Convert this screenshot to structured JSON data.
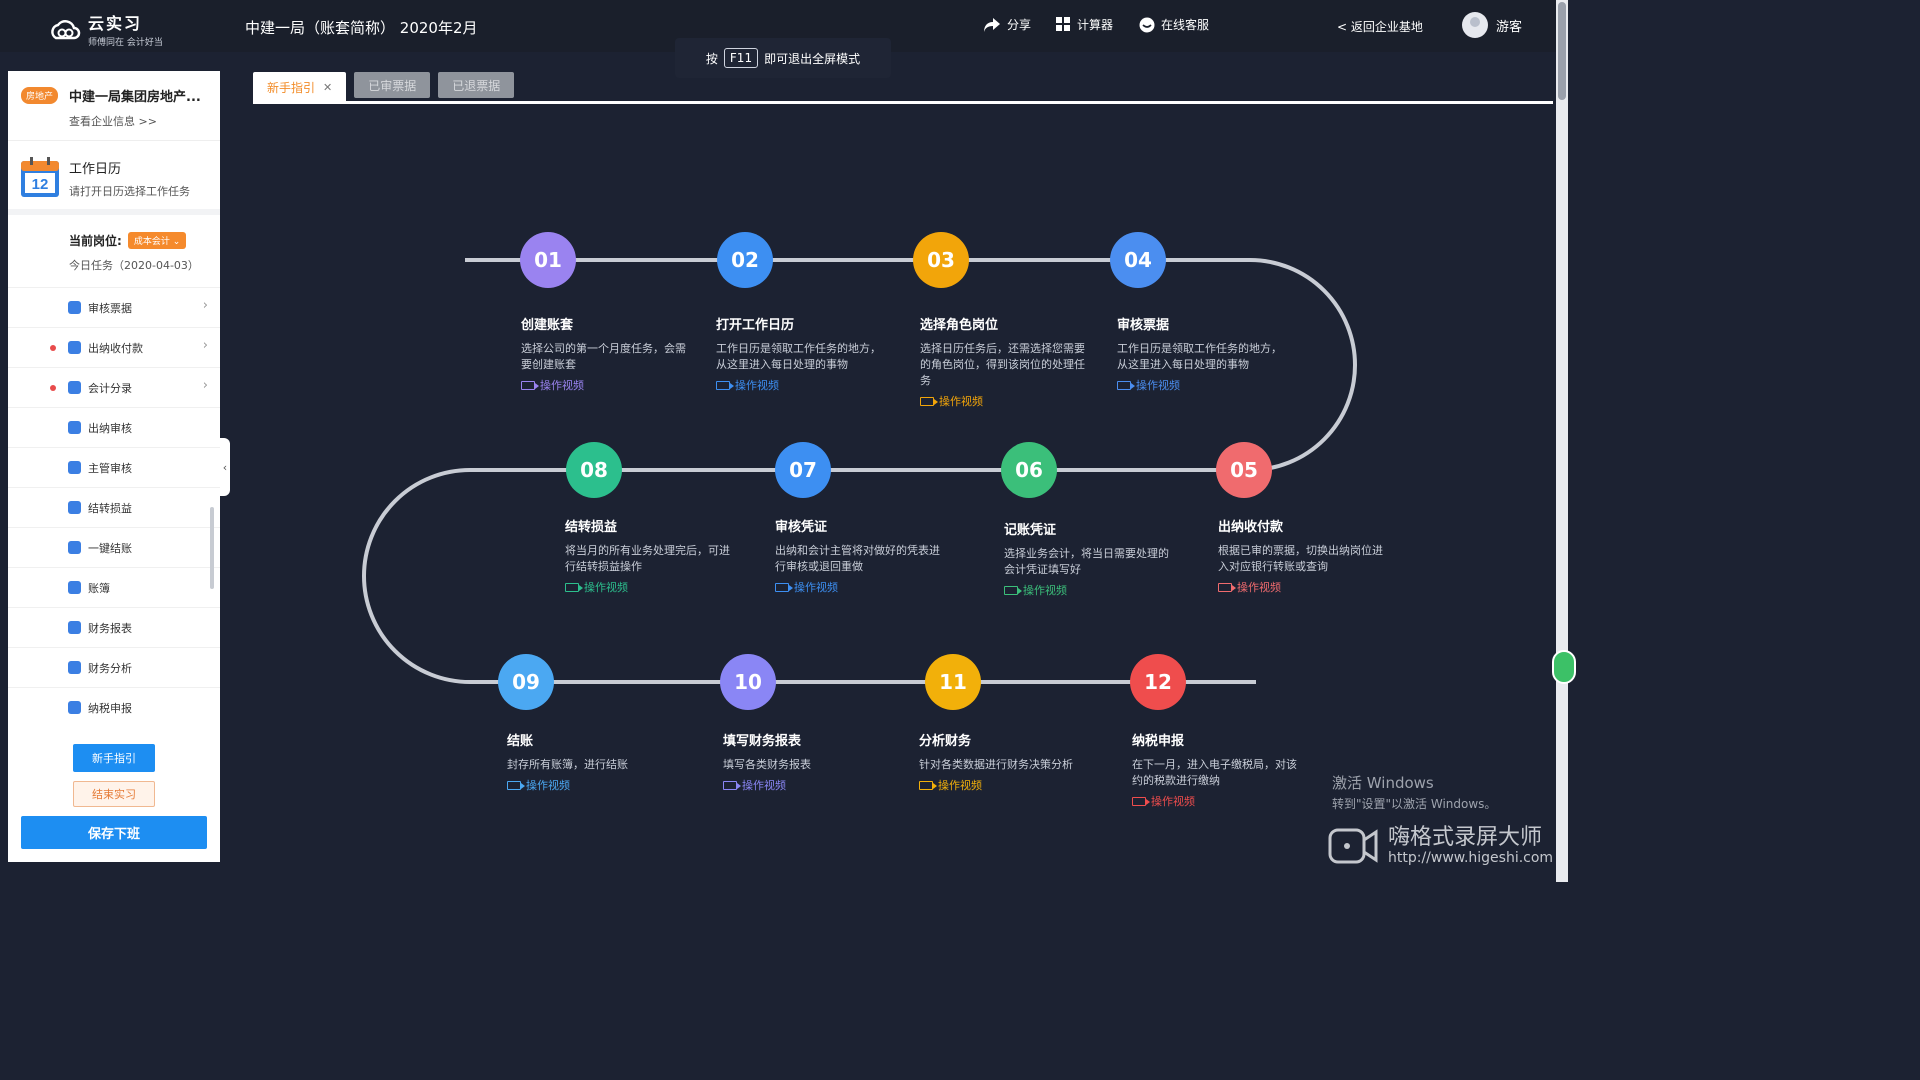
{
  "topbar": {
    "logo_title": "云实习",
    "logo_sub": "师傅同在 会计好当",
    "company_title": "中建一局（账套简称） 2020年2月",
    "f11_press": "按",
    "f11_key": "F11",
    "f11_text": "即可退出全屏模式",
    "share": "分享",
    "calculator": "计算器",
    "support": "在线客服",
    "back": "< 返回企业基地",
    "user": "游客"
  },
  "sidebar": {
    "badge": "房地产",
    "company_name": "中建一局集团房地产...",
    "company_link": "查看企业信息 >>",
    "calendar_day": "12",
    "calendar_title": "工作日历",
    "calendar_sub": "请打开日历选择工作任务",
    "post_label": "当前岗位:",
    "post_value": "成本会计",
    "today": "今日任务（2020-04-03）",
    "items": [
      {
        "label": "审核票据",
        "dot": false,
        "chev": true
      },
      {
        "label": "出纳收付款",
        "dot": true,
        "chev": true
      },
      {
        "label": "会计分录",
        "dot": true,
        "chev": true
      },
      {
        "label": "出纳审核",
        "dot": false,
        "chev": false
      },
      {
        "label": "主管审核",
        "dot": false,
        "chev": false
      },
      {
        "label": "结转损益",
        "dot": false,
        "chev": false
      },
      {
        "label": "一键结账",
        "dot": false,
        "chev": false
      },
      {
        "label": "账簿",
        "dot": false,
        "chev": false
      },
      {
        "label": "财务报表",
        "dot": false,
        "chev": false
      },
      {
        "label": "财务分析",
        "dot": false,
        "chev": false
      },
      {
        "label": "纳税申报",
        "dot": false,
        "chev": false
      }
    ],
    "btn_guide": "新手指引",
    "btn_end": "结束实习",
    "btn_save": "保存下班"
  },
  "tabs": [
    {
      "label": "新手指引",
      "active": true
    },
    {
      "label": "已审票据",
      "active": false
    },
    {
      "label": "已退票据",
      "active": false
    }
  ],
  "video_label": "操作视频",
  "steps": [
    {
      "num": "01",
      "title": "创建账套",
      "desc": "选择公司的第一个月度任务，会需要创建账套",
      "color": "#9a83f0"
    },
    {
      "num": "02",
      "title": "打开工作日历",
      "desc": "工作日历是领取工作任务的地方，从这里进入每日处理的事物",
      "color": "#3d8ff2"
    },
    {
      "num": "03",
      "title": "选择角色岗位",
      "desc": "选择日历任务后，还需选择您需要的角色岗位，得到该岗位的处理任务",
      "color": "#f2a50a"
    },
    {
      "num": "04",
      "title": "审核票据",
      "desc": "工作日历是领取工作任务的地方，从这里进入每日处理的事物",
      "color": "#4b8ef0"
    },
    {
      "num": "05",
      "title": "出纳收付款",
      "desc": "根据已审的票据，切换出纳岗位进入对应银行转账或查询",
      "color": "#f06b6e"
    },
    {
      "num": "06",
      "title": "记账凭证",
      "desc": "选择业务会计，将当日需要处理的会计凭证填写好",
      "color": "#3bbf7a"
    },
    {
      "num": "07",
      "title": "审核凭证",
      "desc": "出纳和会计主管将对做好的凭表进行审核或退回重做",
      "color": "#3d8ff2"
    },
    {
      "num": "08",
      "title": "结转损益",
      "desc": "将当月的所有业务处理完后，可进行结转损益操作",
      "color": "#2cbf8d"
    },
    {
      "num": "09",
      "title": "结账",
      "desc": "封存所有账簿，进行结账",
      "color": "#4ba8f2"
    },
    {
      "num": "10",
      "title": "填写财务报表",
      "desc": "填写各类财务报表",
      "color": "#8a86f5"
    },
    {
      "num": "11",
      "title": "分析财务",
      "desc": "针对各类数据进行财务决策分析",
      "color": "#f2b00a"
    },
    {
      "num": "12",
      "title": "纳税申报",
      "desc": "在下一月，进入电子缴税局，对该约的税款进行缴纳",
      "color": "#ef4d4d"
    }
  ],
  "watermark": {
    "line1": "激活 Windows",
    "line2": "转到\"设置\"以激活 Windows。",
    "brand": "嗨格式录屏大师",
    "url": "http://www.higeshi.com"
  }
}
